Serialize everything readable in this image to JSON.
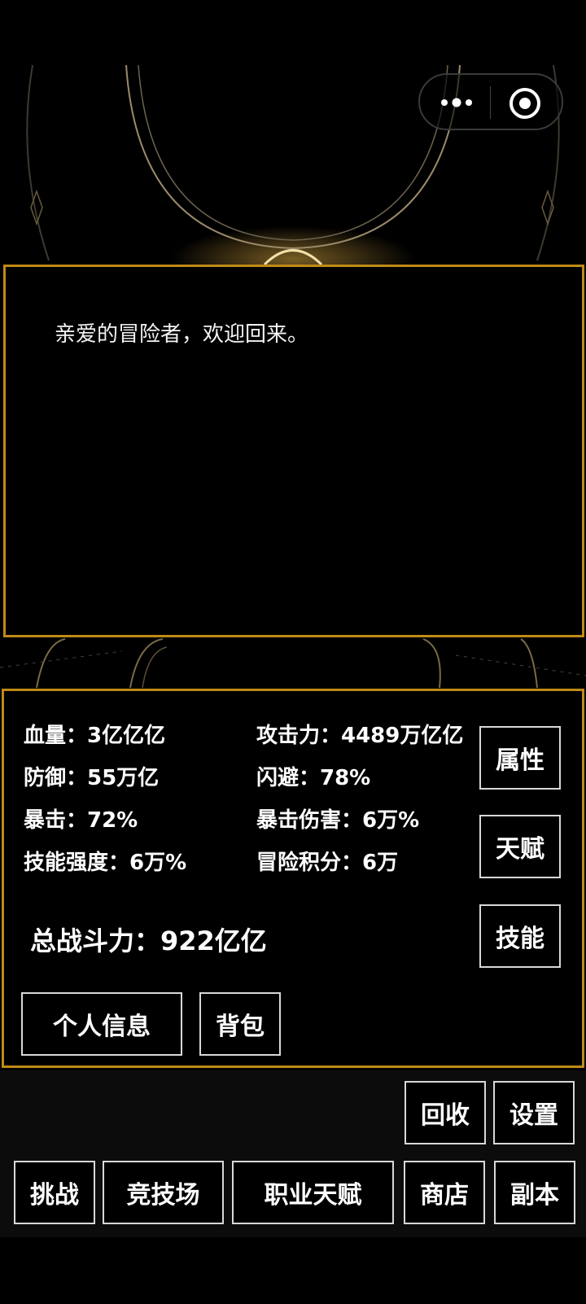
{
  "dialog": {
    "message": "亲爱的冒险者，欢迎回来。"
  },
  "stats": {
    "hp": "血量：3亿亿亿",
    "attack": "攻击力：4489万亿亿",
    "defense": "防御：55万亿",
    "dodge": "闪避：78%",
    "crit": "暴击：72%",
    "crit_damage": "暴击伤害：6万%",
    "skill_power": "技能强度：6万%",
    "adventure_points": "冒险积分：6万",
    "total_power": "总战斗力：922亿亿"
  },
  "side_buttons": {
    "attributes": "属性",
    "talent": "天赋",
    "skills": "技能"
  },
  "panel_buttons": {
    "profile": "个人信息",
    "bag": "背包"
  },
  "bottom_buttons": {
    "recycle": "回收",
    "settings": "设置",
    "challenge": "挑战",
    "arena": "竞技场",
    "class_talent": "职业天赋",
    "shop": "商店",
    "dungeon": "副本"
  },
  "icons": {
    "menu": "more-dots-icon",
    "close": "target-circle-icon"
  },
  "colors": {
    "panel_border": "#c08a17",
    "button_border": "#d8d8d8",
    "background": "#000000"
  }
}
